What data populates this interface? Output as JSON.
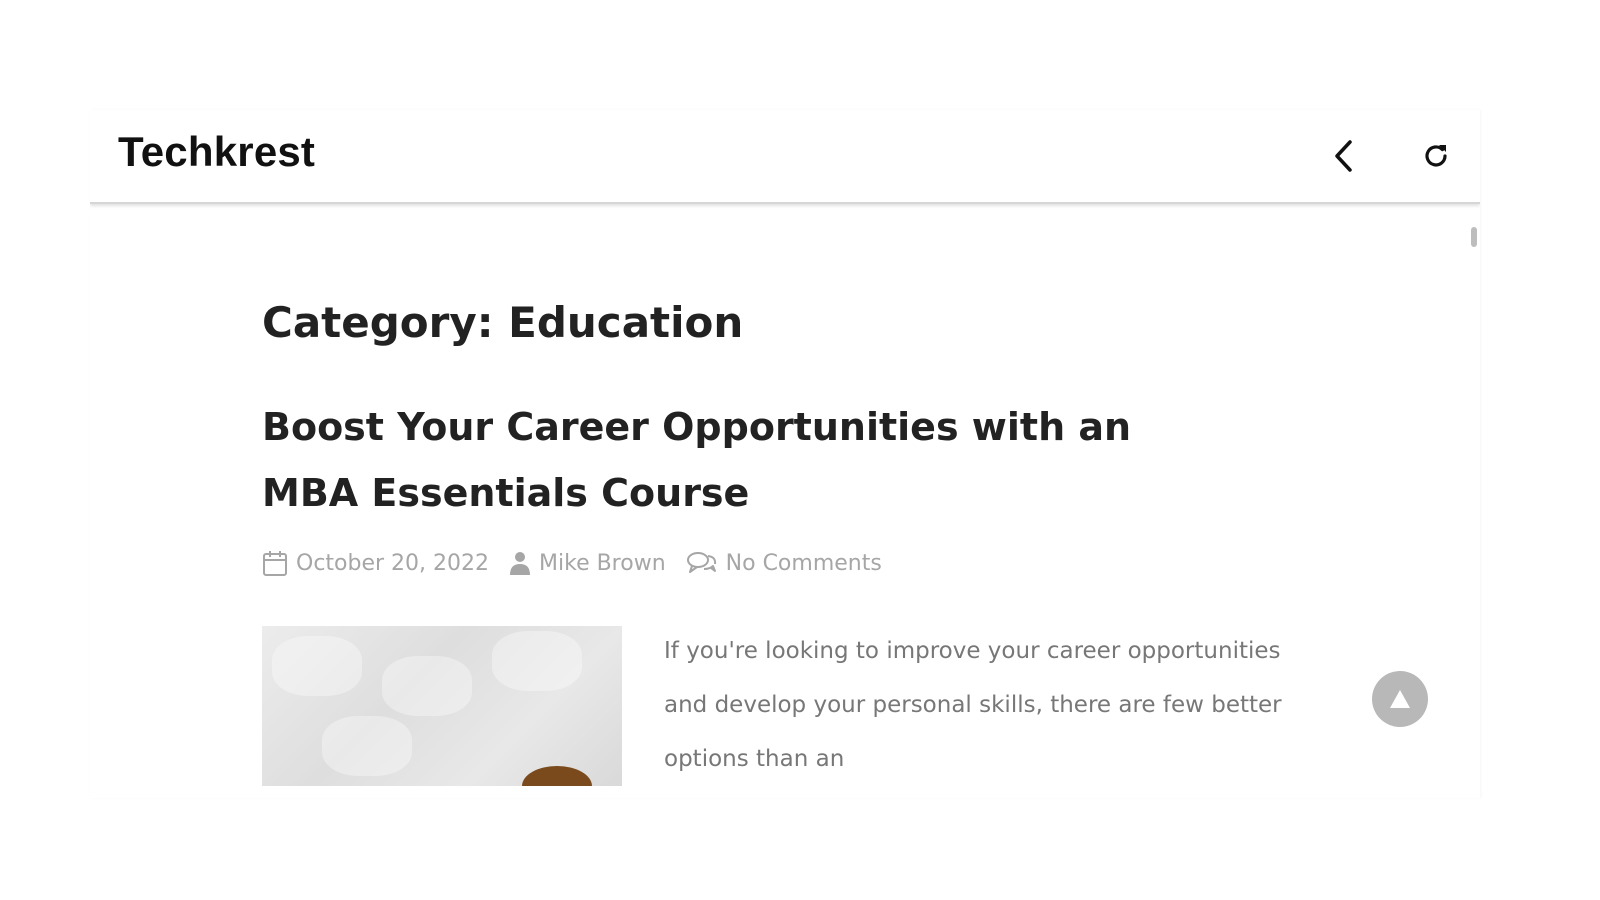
{
  "app": {
    "title": "Techkrest",
    "back_icon": "chevron-left-icon",
    "refresh_icon": "refresh-icon"
  },
  "page": {
    "category_heading": "Category: Education"
  },
  "post": {
    "title": "Boost Your Career Opportunities with an MBA Essentials Course",
    "date": "October 20, 2022",
    "author": "Mike Brown",
    "comments": "No Comments",
    "excerpt": "If you're looking to improve your career opportunities and develop your personal skills, there are few better options than an",
    "date_icon": "calendar-icon",
    "author_icon": "user-icon",
    "comments_icon": "comments-icon"
  },
  "controls": {
    "scroll_top_icon": "arrow-up-icon"
  },
  "colors": {
    "title_text": "#111111",
    "heading_text": "#222222",
    "meta_text": "#a6a6a6",
    "excerpt_text": "#777777",
    "scroll_top_bg": "#b8b8b8"
  }
}
